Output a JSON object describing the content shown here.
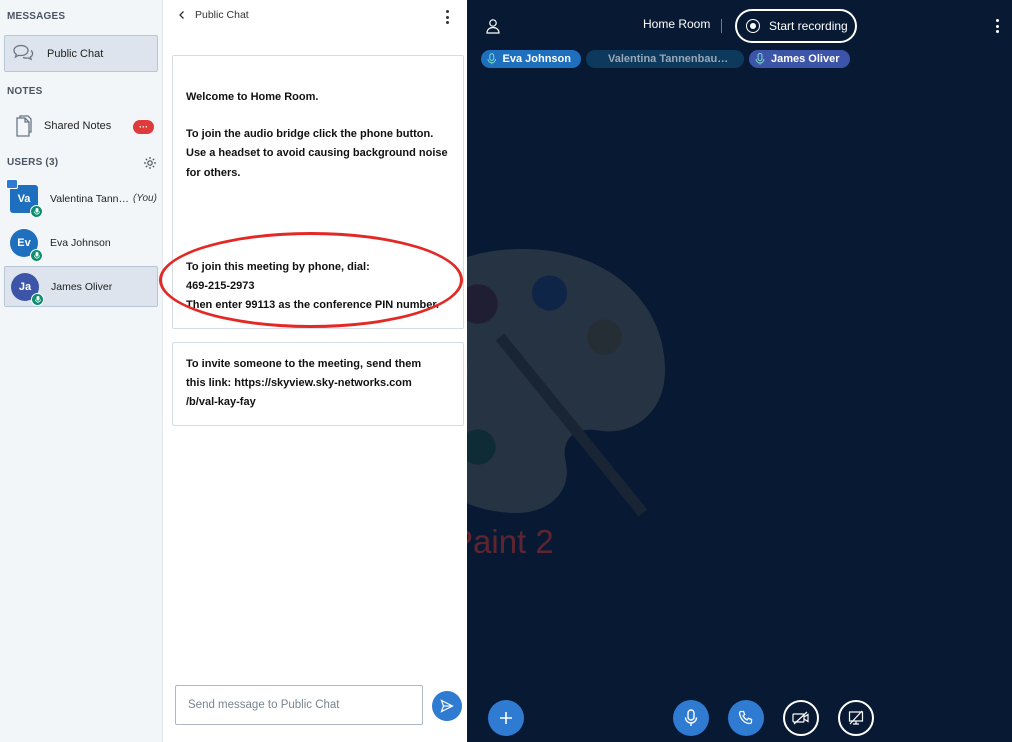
{
  "sidebar": {
    "messages_title": "MESSAGES",
    "public_chat_label": "Public Chat",
    "notes_title": "NOTES",
    "shared_notes_label": "Shared Notes",
    "shared_notes_badge": "···",
    "users_title": "USERS (3)",
    "users": [
      {
        "initials": "Va",
        "name": "Valentina Tann…",
        "you": "(You)",
        "color": "#1f6fbf"
      },
      {
        "initials": "Ev",
        "name": "Eva Johnson",
        "color": "#1f6fbf"
      },
      {
        "initials": "Ja",
        "name": "James Oliver",
        "color": "#3d55a8"
      }
    ]
  },
  "chat": {
    "header": "Public Chat",
    "welcome": {
      "prefix": "Welcome to ",
      "room": "Home Room.",
      "lines": [
        "To join the audio bridge click the phone button.",
        "Use a headset to avoid causing background noise",
        "for others."
      ],
      "phone_lines": [
        "To join this meeting by phone, dial:",
        "469-215-2973",
        "Then enter 99113 as the conference PIN number."
      ]
    },
    "invite_lines": [
      "To invite someone to the meeting, send them",
      "this link: https://skyview.sky-networks.com",
      "/b/val-kay-fay"
    ],
    "input_placeholder": "Send message to Public Chat"
  },
  "stage": {
    "room_title": "Home Room",
    "record_label": "Start recording",
    "talkers": [
      {
        "name": "Eva Johnson",
        "color": "#1f6fbf"
      },
      {
        "name": "Valentina Tannenbau…",
        "color": "#0d3a5c"
      },
      {
        "name": "James Oliver",
        "color": "#3d55a8"
      }
    ],
    "watermark_text": "Paint 2"
  },
  "colors": {
    "accent": "#2f7bd1",
    "stage_bg": "#081a33",
    "alert": "#de3b3b",
    "mic_badge": "#0d8f6e"
  }
}
